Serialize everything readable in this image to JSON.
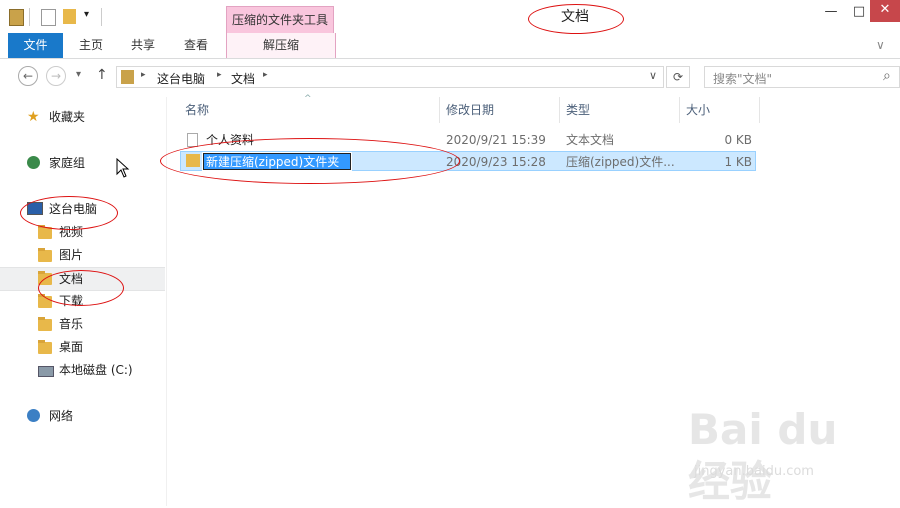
{
  "window": {
    "title": "文档",
    "context_tab_header": "压缩的文件夹工具",
    "minimize": "—",
    "maximize": "□",
    "close": "✕"
  },
  "ribbon": {
    "tabs": [
      "文件",
      "主页",
      "共享",
      "查看",
      "解压缩"
    ],
    "expand": "∨",
    "help": "?"
  },
  "address": {
    "back": "←",
    "forward": "→",
    "history": "▾",
    "up": "↑",
    "breadcrumb": [
      "这台电脑",
      "文档"
    ],
    "separator": "▸",
    "dropdown": "∨",
    "refresh": "⟳",
    "search_placeholder": "搜索\"文档\"",
    "search_icon": "⌕"
  },
  "sidebar": {
    "items": [
      {
        "label": "收藏夹",
        "icon": "star-icon"
      },
      {
        "label": "家庭组",
        "icon": "homegroup-icon"
      },
      {
        "label": "这台电脑",
        "icon": "computer-icon"
      },
      {
        "label": "视频",
        "icon": "folder-icon"
      },
      {
        "label": "图片",
        "icon": "folder-icon"
      },
      {
        "label": "文档",
        "icon": "folder-icon"
      },
      {
        "label": "下载",
        "icon": "folder-icon"
      },
      {
        "label": "音乐",
        "icon": "folder-icon"
      },
      {
        "label": "桌面",
        "icon": "folder-icon"
      },
      {
        "label": "本地磁盘 (C:)",
        "icon": "drive-icon"
      },
      {
        "label": "网络",
        "icon": "network-icon"
      }
    ]
  },
  "file_list": {
    "columns": [
      "名称",
      "修改日期",
      "类型",
      "大小"
    ],
    "sort_indicator": "^",
    "rows": [
      {
        "name": "个人资料",
        "modified": "2020/9/21 15:39",
        "type": "文本文档",
        "size": "0 KB",
        "icon": "text-file-icon"
      },
      {
        "name": "新建压缩(zipped)文件夹",
        "modified": "2020/9/23 15:28",
        "type": "压缩(zipped)文件...",
        "size": "1 KB",
        "icon": "zip-folder-icon"
      }
    ]
  },
  "watermark": {
    "brand": "Bai du 经验",
    "url": "jingyan.baidu.com"
  }
}
